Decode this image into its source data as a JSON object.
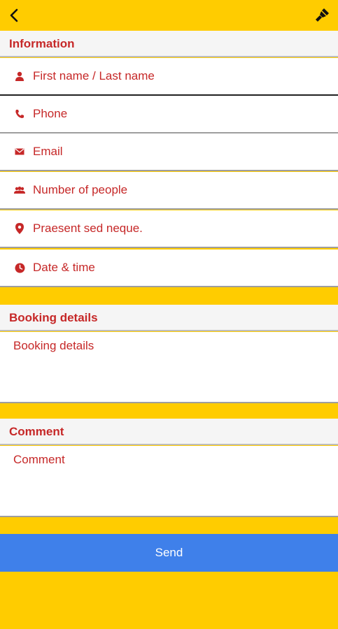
{
  "toolbar": {
    "back_icon": "chevron-left-icon",
    "style_icon": "brush-icon"
  },
  "information": {
    "header": "Information",
    "fields": [
      {
        "icon": "person-icon",
        "placeholder": "First name / Last name"
      },
      {
        "icon": "phone-icon",
        "placeholder": "Phone"
      },
      {
        "icon": "envelope-icon",
        "placeholder": "Email"
      },
      {
        "icon": "group-icon",
        "placeholder": "Number of people"
      },
      {
        "icon": "map-pin-icon",
        "placeholder": "Praesent sed neque."
      },
      {
        "icon": "clock-icon",
        "placeholder": "Date & time"
      }
    ]
  },
  "booking": {
    "header": "Booking details",
    "placeholder": "Booking details"
  },
  "comment": {
    "header": "Comment",
    "placeholder": "Comment"
  },
  "send_button": "Send",
  "colors": {
    "accent_yellow": "#FFCC00",
    "label_red": "#C62828",
    "button_blue": "#3F80EA"
  }
}
